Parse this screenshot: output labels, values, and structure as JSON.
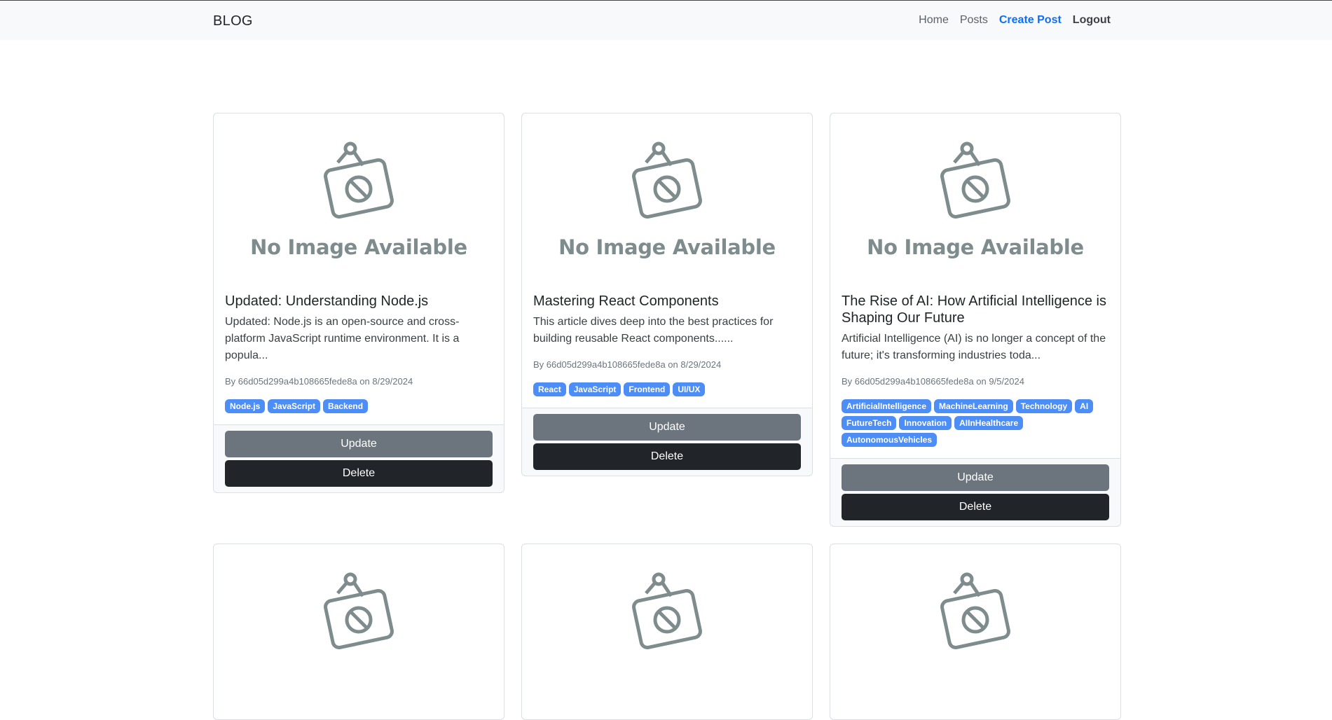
{
  "navbar": {
    "brand": "BLOG",
    "links": [
      {
        "label": "Home"
      },
      {
        "label": "Posts"
      },
      {
        "label": "Create Post"
      },
      {
        "label": "Logout"
      }
    ]
  },
  "placeholder_text": "No Image Available",
  "posts": [
    {
      "title": "Updated: Understanding Node.js",
      "excerpt": "Updated: Node.js is an open-source and cross-platform JavaScript runtime environment. It is a popula...",
      "meta": "By 66d05d299a4b108665fede8a on 8/29/2024",
      "tags": [
        "Node.js",
        "JavaScript",
        "Backend"
      ],
      "update_label": "Update",
      "delete_label": "Delete"
    },
    {
      "title": "Mastering React Components",
      "excerpt": "This article dives deep into the best practices for building reusable React components......",
      "meta": "By 66d05d299a4b108665fede8a on 8/29/2024",
      "tags": [
        "React",
        "JavaScript",
        "Frontend",
        "UI/UX"
      ],
      "update_label": "Update",
      "delete_label": "Delete"
    },
    {
      "title": "The Rise of AI: How Artificial Intelligence is Shaping Our Future",
      "excerpt": "Artificial Intelligence (AI) is no longer a concept of the future; it's transforming industries toda...",
      "meta": "By 66d05d299a4b108665fede8a on 9/5/2024",
      "tags": [
        "ArtificialIntelligence",
        "MachineLearning",
        "Technology",
        "AI",
        "FutureTech",
        "Innovation",
        "AIInHealthcare",
        "AutonomousVehicles"
      ],
      "update_label": "Update",
      "delete_label": "Delete"
    }
  ],
  "colors": {
    "accent": "#0d6efd",
    "tag": "#4c8df6",
    "update_button": "#6c757d",
    "delete_button": "#212529",
    "placeholder_gray": "#7f8c8d"
  }
}
